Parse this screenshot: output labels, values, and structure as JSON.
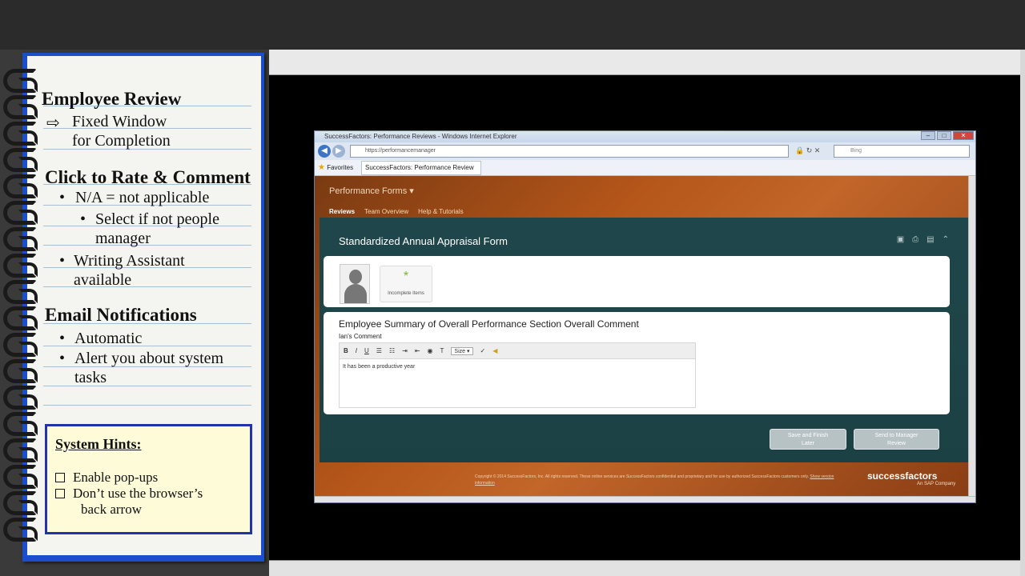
{
  "notebook": {
    "section1_title": "Employee Review",
    "section1_arrow": "⇨",
    "section1_line1": "Fixed Window",
    "section1_line2": "for Completion",
    "section2_title": "Click to Rate & Comment",
    "section2_b1": "N/A = not applicable",
    "section2_b1a_line1": "Select if not people",
    "section2_b1a_line2": "manager",
    "section2_b2_line1": "Writing Assistant",
    "section2_b2_line2": "available",
    "section3_title": "Email Notifications",
    "section3_b1": "Automatic",
    "section3_b2_line1": "Alert you about system",
    "section3_b2_line2": "tasks",
    "bullet": "•"
  },
  "hints": {
    "title": "System Hints:",
    "item1": "Enable pop-ups",
    "item2_line1": "Don’t use the browser’s",
    "item2_line2": "back arrow"
  },
  "browser": {
    "title": "SuccessFactors: Performance Reviews - Windows Internet Explorer",
    "url": "https://performancemanager",
    "search_placeholder": "Bing",
    "favorites": "Favorites",
    "tab_title": "SuccessFactors: Performance Review"
  },
  "app": {
    "menu": "Performance Forms ▾",
    "nav": [
      "Reviews",
      "Team Overview",
      "Help & Tutorials"
    ],
    "form_title": "Standardized Annual Appraisal Form",
    "incomplete_label": "Incomplete Items",
    "summary_title": "Employee Summary of Overall Performance Section Overall Comment",
    "comment_label": "Ian's Comment",
    "size_label": "Size",
    "comment_text": "It has been a productive year",
    "save_line1": "Save and Finish",
    "save_line2": "Later",
    "send_line1": "Send to Manager",
    "send_line2": "Review",
    "copyright": "Copyright © 2014 SuccessFactors, Inc. All rights reserved. These online services are SuccessFactors confidential and proprietary and for use by authorized SuccessFactors customers only.",
    "version_link": "Show version information",
    "logo": "successfactors",
    "logo_sub": "An SAP Company"
  }
}
